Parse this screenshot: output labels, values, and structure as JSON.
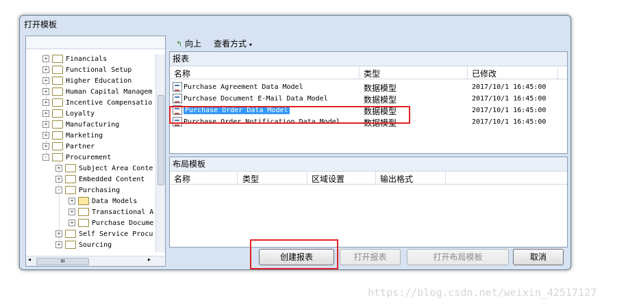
{
  "window": {
    "title": "打开模板"
  },
  "tree": {
    "nodes": [
      {
        "label": "Financials",
        "state": "+",
        "level": 0
      },
      {
        "label": "Functional Setup",
        "state": "+",
        "level": 0
      },
      {
        "label": "Higher Education",
        "state": "+",
        "level": 0
      },
      {
        "label": "Human Capital Managem",
        "state": "+",
        "level": 0
      },
      {
        "label": "Incentive Compensatio",
        "state": "+",
        "level": 0
      },
      {
        "label": "Loyalty",
        "state": "+",
        "level": 0
      },
      {
        "label": "Manufacturing",
        "state": "+",
        "level": 0
      },
      {
        "label": "Marketing",
        "state": "+",
        "level": 0
      },
      {
        "label": "Partner",
        "state": "+",
        "level": 0
      },
      {
        "label": "Procurement",
        "state": "-",
        "level": 0
      },
      {
        "label": "Subject Area Conte",
        "state": "+",
        "level": 1
      },
      {
        "label": "Embedded Content",
        "state": "+",
        "level": 1
      },
      {
        "label": "Purchasing",
        "state": "-",
        "level": 1
      },
      {
        "label": "Data Models",
        "state": "+",
        "level": 2
      },
      {
        "label": "Transactional A",
        "state": "+",
        "level": 2
      },
      {
        "label": "Purchase Docume",
        "state": "+",
        "level": 2
      },
      {
        "label": "Self Service Procu",
        "state": "+",
        "level": 1
      },
      {
        "label": "Sourcing",
        "state": "+",
        "level": 1
      }
    ],
    "hscroll_label": "III"
  },
  "toolbar": {
    "up_label": "向上",
    "view_label": "查看方式"
  },
  "reports": {
    "title": "报表",
    "columns": [
      "名称",
      "类型",
      "已修改"
    ],
    "rows": [
      {
        "name": "Purchase Agreement Data Model",
        "type": "数据模型",
        "modified": "2017/10/1 16:45:00"
      },
      {
        "name": "Purchase Document E-Mail Data Model",
        "type": "数据模型",
        "modified": "2017/10/1 16:45:00"
      },
      {
        "name": "Purchase Order Data Model",
        "type": "数据模型",
        "modified": "2017/10/1 16:45:00"
      },
      {
        "name": "Purchase Order Notification Data Model",
        "type": "数据模型",
        "modified": "2017/10/1 16:45:00"
      }
    ]
  },
  "layout_templates": {
    "title": "布局模板",
    "columns": [
      "名称",
      "类型",
      "区域设置",
      "输出格式"
    ]
  },
  "buttons": {
    "create": "创建报表",
    "open_report": "打开报表",
    "open_layout": "打开布局模板",
    "cancel": "取消"
  },
  "watermark": "https://blog.csdn.net/weixin_42517127",
  "colors": {
    "selection": "#3399ff",
    "highlight_box": "#e02020"
  }
}
